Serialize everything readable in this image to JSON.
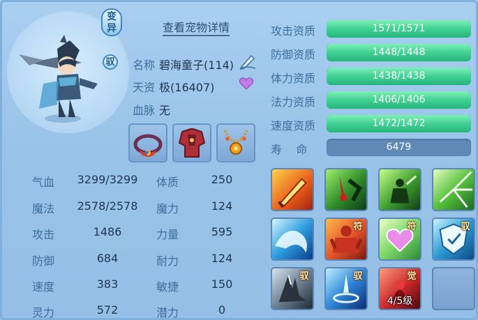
{
  "pet": {
    "variant_badge": "变异",
    "ride_badge": "驭",
    "detail_link": "查看宠物详情",
    "name_label": "名称",
    "name_value": "碧海童子(114)",
    "aptitude_label": "天资",
    "aptitude_value": "极(16407)",
    "bloodline_label": "血脉",
    "bloodline_value": "无"
  },
  "equipment": [
    "collar-icon",
    "armor-icon",
    "necklace-icon"
  ],
  "stats": [
    {
      "label": "气血",
      "value": "3299/3299"
    },
    {
      "label": "魔法",
      "value": "2578/2578"
    },
    {
      "label": "攻击",
      "value": "1486"
    },
    {
      "label": "防御",
      "value": "684"
    },
    {
      "label": "速度",
      "value": "383"
    },
    {
      "label": "灵力",
      "value": "572"
    }
  ],
  "attributes": [
    {
      "label": "体质",
      "value": "250"
    },
    {
      "label": "魔力",
      "value": "124"
    },
    {
      "label": "力量",
      "value": "595"
    },
    {
      "label": "耐力",
      "value": "124"
    },
    {
      "label": "敏捷",
      "value": "150"
    },
    {
      "label": "潜力",
      "value": "0"
    }
  ],
  "qualifications": [
    {
      "label": "攻击资质",
      "text": "1571/1571",
      "fill": 1.0
    },
    {
      "label": "防御资质",
      "text": "1448/1448",
      "fill": 1.0
    },
    {
      "label": "体力资质",
      "text": "1438/1438",
      "fill": 1.0
    },
    {
      "label": "法力资质",
      "text": "1406/1406",
      "fill": 1.0
    },
    {
      "label": "速度资质",
      "text": "1472/1472",
      "fill": 1.0
    }
  ],
  "life": {
    "label": "寿    命",
    "text": "6479"
  },
  "skills": [
    {
      "icon": "flame-sword-skill-icon",
      "tag": "",
      "level": ""
    },
    {
      "icon": "blood-strike-skill-icon",
      "tag": "",
      "level": ""
    },
    {
      "icon": "shadow-warrior-skill-icon",
      "tag": "",
      "level": ""
    },
    {
      "icon": "green-burst-skill-icon",
      "tag": "",
      "level": ""
    },
    {
      "icon": "water-wave-skill-icon",
      "tag": "",
      "level": ""
    },
    {
      "icon": "red-giant-skill-icon",
      "tag": "符",
      "level": ""
    },
    {
      "icon": "heart-skill-icon",
      "tag": "符",
      "level": ""
    },
    {
      "icon": "shield-skill-icon",
      "tag": "驭",
      "level": ""
    },
    {
      "icon": "dark-wing-skill-icon",
      "tag": "驭",
      "level": ""
    },
    {
      "icon": "whirlwind-skill-icon",
      "tag": "驭",
      "level": ""
    },
    {
      "icon": "crimson-awaken-skill-icon",
      "tag": "觉",
      "level": "4/5级"
    },
    {
      "icon": "empty-slot",
      "tag": "",
      "level": ""
    }
  ]
}
